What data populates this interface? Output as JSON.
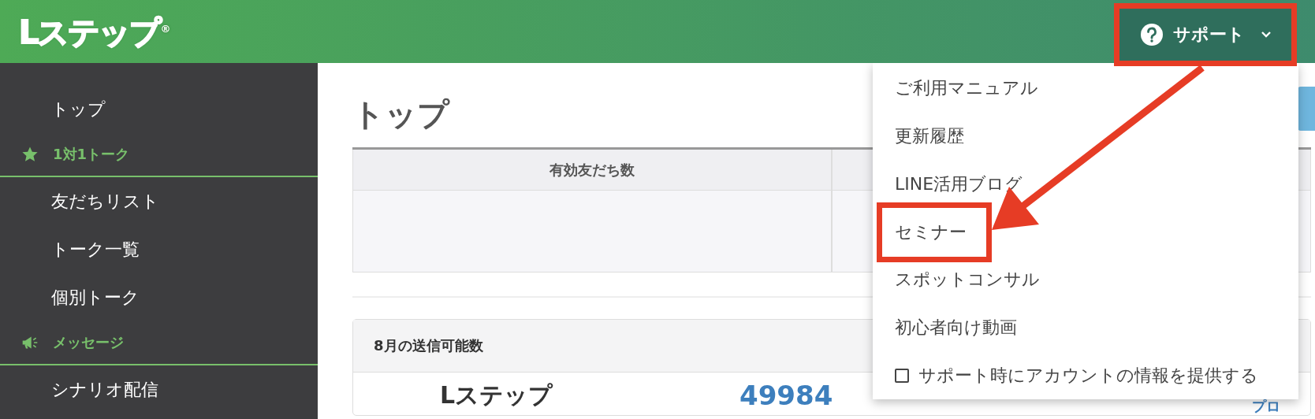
{
  "header": {
    "logo": "Lステップ",
    "logo_mark": "®",
    "support": {
      "label": "サポート",
      "expanded": true,
      "highlighted": true
    }
  },
  "sidebar": {
    "items": [
      {
        "kind": "link",
        "label": "トップ"
      },
      {
        "kind": "section",
        "label": "1対1トーク"
      },
      {
        "kind": "link",
        "label": "友だちリスト"
      },
      {
        "kind": "link",
        "label": "トーク一覧"
      },
      {
        "kind": "link",
        "label": "個別トーク"
      },
      {
        "kind": "section",
        "label": "メッセージ"
      },
      {
        "kind": "link",
        "label": "シナリオ配信"
      }
    ]
  },
  "page": {
    "title": "トップ",
    "table": {
      "columns": [
        "有効友だち数"
      ]
    },
    "card": {
      "title": "8月の送信可能数",
      "plan": "Lステップ",
      "remaining": "49984",
      "plan_type": "プロ"
    }
  },
  "support_menu": [
    {
      "kind": "link",
      "label": "ご利用マニュアル",
      "highlighted": false
    },
    {
      "kind": "link",
      "label": "更新履歴",
      "highlighted": false
    },
    {
      "kind": "link",
      "label": "LINE活用ブログ",
      "highlighted": false
    },
    {
      "kind": "link",
      "label": "セミナー",
      "highlighted": true
    },
    {
      "kind": "link",
      "label": "スポットコンサル",
      "highlighted": false
    },
    {
      "kind": "link",
      "label": "初心者向け動画",
      "highlighted": false
    },
    {
      "kind": "checkbox",
      "label": "サポート時にアカウントの情報を提供する",
      "checked": false,
      "highlighted": false
    }
  ]
}
